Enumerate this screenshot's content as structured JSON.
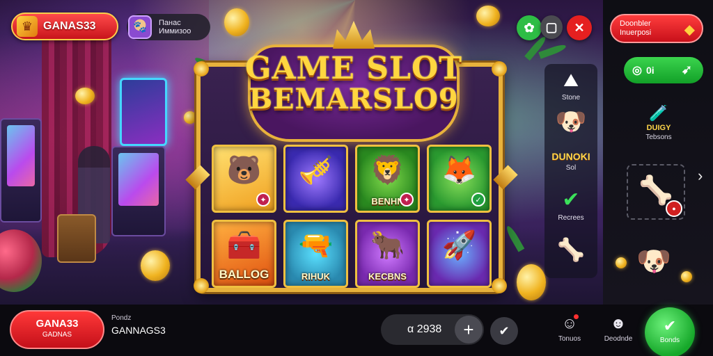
{
  "brand": {
    "name": "GANAS33"
  },
  "user": {
    "name": "Панас\nИммизоо"
  },
  "title": {
    "line1": "GAME SLOT",
    "line2": "BEMARSLO9"
  },
  "reels": [
    {
      "label": "",
      "icon": "bear-symbol-icon"
    },
    {
      "label": "",
      "icon": "cannon-symbol-icon"
    },
    {
      "label": "BENHN",
      "icon": "lion-symbol-icon"
    },
    {
      "label": "",
      "icon": "fox-symbol-icon"
    },
    {
      "label": "BALLOG",
      "icon": "chest-symbol-icon"
    },
    {
      "label": "RIHUK",
      "icon": "gun-symbol-icon"
    },
    {
      "label": "KECBNS",
      "icon": "bull-symbol-icon"
    },
    {
      "label": "",
      "icon": "rocket-symbol-icon"
    }
  ],
  "side_column": [
    {
      "label": "Stone"
    },
    {
      "label": ""
    },
    {
      "label": "Sol",
      "title": "DUNOKI"
    },
    {
      "label": "Recrees"
    },
    {
      "label": ""
    }
  ],
  "right_panel": {
    "notice": "Doonbler\nInuerposi",
    "green_pill": "0i",
    "items": [
      {
        "title": "DUIGY",
        "label": "Tebsons"
      },
      {
        "label": ""
      },
      {
        "label": ""
      }
    ]
  },
  "bottom": {
    "brand_title": "GANA33",
    "brand_sub": "GADNAS",
    "info_small": "Pondz",
    "info_main": "GANNAGS3",
    "balance": "α 2938",
    "nav": [
      {
        "label": "Tonuos",
        "icon": "user-notification-icon"
      },
      {
        "label": "Deodnde",
        "icon": "profile-icon"
      }
    ],
    "big_button": "Bonds"
  },
  "colors": {
    "brand_red": "#d81a1f",
    "gold": "#e8b23c",
    "green": "#1fb236"
  }
}
